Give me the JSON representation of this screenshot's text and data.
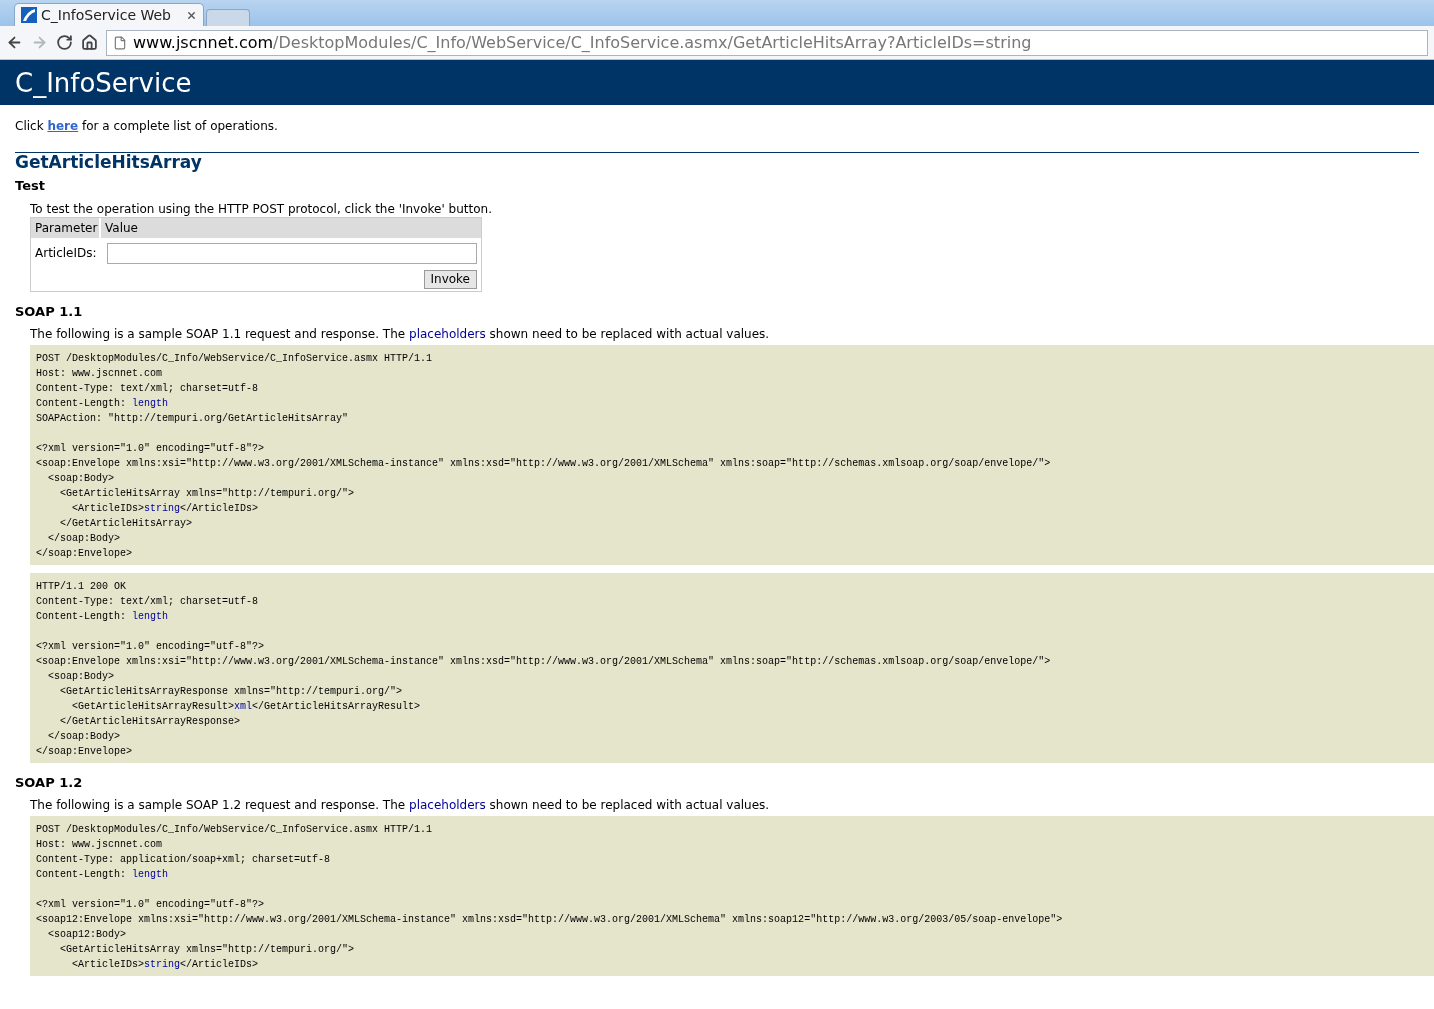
{
  "browser": {
    "tabs": [
      {
        "title": "C_InfoService Web",
        "selected": true
      },
      {
        "selected": false
      }
    ],
    "nav": [
      {
        "kind": "back",
        "disabled": false
      },
      {
        "kind": "forward",
        "disabled": true
      },
      {
        "kind": "reload",
        "disabled": false
      },
      {
        "kind": "home",
        "disabled": false
      }
    ],
    "address": {
      "host": "www.jscnnet.com",
      "path": "/DesktopModules/C_Info/WebService/C_InfoService.asmx/GetArticleHitsArray?ArticleIDs=string"
    }
  },
  "header": {
    "title": "C_InfoService"
  },
  "intro": {
    "before": "Click ",
    "link": "here",
    "after": " for a complete list of operations."
  },
  "operation": {
    "title": "GetArticleHitsArray"
  },
  "test": {
    "heading": "Test",
    "text": "To test the operation using the HTTP POST protocol, click the 'Invoke' button.",
    "columns": [
      "Parameter",
      "Value"
    ],
    "params": [
      {
        "label": "ArticleIDs:"
      }
    ],
    "button": "Invoke"
  },
  "sections": [
    {
      "heading": "SOAP 1.1",
      "text": [
        {
          "text": "The following is a sample SOAP 1.1 request and response. The ",
          "placeholder": false
        },
        {
          "text": "placeholders",
          "placeholder": true
        },
        {
          "text": " shown need to be replaced with actual values.",
          "placeholder": false
        }
      ],
      "blocks": [
        [
          [
            [
              {
                "text": "POST /DesktopModules/C_Info/WebService/C_InfoService.asmx HTTP/1.1",
                "placeholder": false
              }
            ],
            [
              {
                "text": "Host: www.jscnnet.com",
                "placeholder": false
              }
            ],
            [
              {
                "text": "Content-Type: text/xml; charset=utf-8",
                "placeholder": false
              }
            ],
            [
              {
                "text": "Content-Length: ",
                "placeholder": false
              },
              {
                "text": "length",
                "placeholder": true
              }
            ],
            [
              {
                "text": "SOAPAction: \"http://tempuri.org/GetArticleHitsArray\"",
                "placeholder": false
              }
            ]
          ],
          [
            [
              {
                "text": "<?xml version=\"1.0\" encoding=\"utf-8\"?>",
                "placeholder": false
              }
            ],
            [
              {
                "text": "<soap:Envelope xmlns:xsi=\"http://www.w3.org/2001/XMLSchema-instance\" xmlns:xsd=\"http://www.w3.org/2001/XMLSchema\" xmlns:soap=\"http://schemas.xmlsoap.org/soap/envelope/\">",
                "placeholder": false
              }
            ],
            [
              {
                "text": "  <soap:Body>",
                "placeholder": false
              }
            ],
            [
              {
                "text": "    <GetArticleHitsArray xmlns=\"http://tempuri.org/\">",
                "placeholder": false
              }
            ],
            [
              {
                "text": "      <ArticleIDs>",
                "placeholder": false
              },
              {
                "text": "string",
                "placeholder": true
              },
              {
                "text": "</ArticleIDs>",
                "placeholder": false
              }
            ],
            [
              {
                "text": "    </GetArticleHitsArray>",
                "placeholder": false
              }
            ],
            [
              {
                "text": "  </soap:Body>",
                "placeholder": false
              }
            ],
            [
              {
                "text": "</soap:Envelope>",
                "placeholder": false
              }
            ]
          ]
        ],
        [
          [
            [
              {
                "text": "HTTP/1.1 200 OK",
                "placeholder": false
              }
            ],
            [
              {
                "text": "Content-Type: text/xml; charset=utf-8",
                "placeholder": false
              }
            ],
            [
              {
                "text": "Content-Length: ",
                "placeholder": false
              },
              {
                "text": "length",
                "placeholder": true
              }
            ]
          ],
          [
            [
              {
                "text": "<?xml version=\"1.0\" encoding=\"utf-8\"?>",
                "placeholder": false
              }
            ],
            [
              {
                "text": "<soap:Envelope xmlns:xsi=\"http://www.w3.org/2001/XMLSchema-instance\" xmlns:xsd=\"http://www.w3.org/2001/XMLSchema\" xmlns:soap=\"http://schemas.xmlsoap.org/soap/envelope/\">",
                "placeholder": false
              }
            ],
            [
              {
                "text": "  <soap:Body>",
                "placeholder": false
              }
            ],
            [
              {
                "text": "    <GetArticleHitsArrayResponse xmlns=\"http://tempuri.org/\">",
                "placeholder": false
              }
            ],
            [
              {
                "text": "      <GetArticleHitsArrayResult>",
                "placeholder": false
              },
              {
                "text": "xml",
                "placeholder": true
              },
              {
                "text": "</GetArticleHitsArrayResult>",
                "placeholder": false
              }
            ],
            [
              {
                "text": "    </GetArticleHitsArrayResponse>",
                "placeholder": false
              }
            ],
            [
              {
                "text": "  </soap:Body>",
                "placeholder": false
              }
            ],
            [
              {
                "text": "</soap:Envelope>",
                "placeholder": false
              }
            ]
          ]
        ]
      ]
    },
    {
      "heading": "SOAP 1.2",
      "text": [
        {
          "text": "The following is a sample SOAP 1.2 request and response. The ",
          "placeholder": false
        },
        {
          "text": "placeholders",
          "placeholder": true
        },
        {
          "text": " shown need to be replaced with actual values.",
          "placeholder": false
        }
      ],
      "blocks": [
        [
          [
            [
              {
                "text": "POST /DesktopModules/C_Info/WebService/C_InfoService.asmx HTTP/1.1",
                "placeholder": false
              }
            ],
            [
              {
                "text": "Host: www.jscnnet.com",
                "placeholder": false
              }
            ],
            [
              {
                "text": "Content-Type: application/soap+xml; charset=utf-8",
                "placeholder": false
              }
            ],
            [
              {
                "text": "Content-Length: ",
                "placeholder": false
              },
              {
                "text": "length",
                "placeholder": true
              }
            ]
          ],
          [
            [
              {
                "text": "<?xml version=\"1.0\" encoding=\"utf-8\"?>",
                "placeholder": false
              }
            ],
            [
              {
                "text": "<soap12:Envelope xmlns:xsi=\"http://www.w3.org/2001/XMLSchema-instance\" xmlns:xsd=\"http://www.w3.org/2001/XMLSchema\" xmlns:soap12=\"http://www.w3.org/2003/05/soap-envelope\">",
                "placeholder": false
              }
            ],
            [
              {
                "text": "  <soap12:Body>",
                "placeholder": false
              }
            ],
            [
              {
                "text": "    <GetArticleHitsArray xmlns=\"http://tempuri.org/\">",
                "placeholder": false
              }
            ],
            [
              {
                "text": "      <ArticleIDs>",
                "placeholder": false
              },
              {
                "text": "string",
                "placeholder": true
              },
              {
                "text": "</ArticleIDs>",
                "placeholder": false
              }
            ]
          ]
        ]
      ]
    }
  ]
}
